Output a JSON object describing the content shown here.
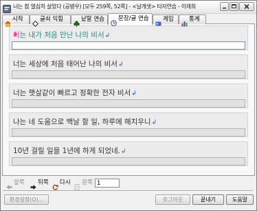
{
  "window": {
    "title": "너는 참 열심히 살았다 (공병우) [모두 259쪽, 52쪽] - <날개셋> 타자연습 - 이재희",
    "icon": "app-icon",
    "controls": [
      "minimize-icon",
      "maximize-icon",
      "close-icon"
    ]
  },
  "tabs": [
    {
      "label": "시작",
      "icon": "start-icon",
      "active": false
    },
    {
      "label": "글쇠 익힘",
      "icon": "keycap-icon",
      "active": false
    },
    {
      "label": "낱말 연습",
      "icon": "clubs-icon",
      "active": false
    },
    {
      "label": "문장/글 연습",
      "icon": "clock-icon",
      "active": true
    },
    {
      "label": "게임",
      "icon": "game-icon",
      "active": false
    },
    {
      "label": "통계",
      "icon": "bar-chart-icon",
      "active": false
    }
  ],
  "practice": {
    "line_end_symbol": "↲",
    "lines": [
      {
        "text": "너는 내가 처음 만난 나의 비서",
        "typed": "",
        "current": true
      },
      {
        "text": "너는 세상에 처음 태어난 나의 비서",
        "typed": "",
        "current": false
      },
      {
        "text": "너는 햇살같이 빠르고 정확한 전자 비서",
        "typed": "",
        "current": false
      },
      {
        "text": "나는 네 도움으로 백날 할 일, 하루에 해치우니",
        "typed": "",
        "current": false
      },
      {
        "text": "10년 걸릴 일을 1년에 하게 되었네.",
        "typed": "",
        "current": false
      }
    ]
  },
  "nav": {
    "prev": {
      "label": "앞쪽",
      "icon": "arrow-left-icon",
      "enabled": false
    },
    "next": {
      "label": "뒤쪽",
      "icon": "arrow-right-icon",
      "enabled": true
    },
    "again": {
      "label": "다시",
      "icon": "refresh-icon",
      "enabled": true
    },
    "goto": {
      "label": "갈쪽",
      "icon": "page-icon",
      "enabled": false
    },
    "page_value": "1"
  },
  "buttons": {
    "settings": {
      "label": "환경설정(O)...",
      "enabled": false
    },
    "logout": {
      "label": "로그아웃",
      "enabled": false
    },
    "exit": {
      "label": "끝내기",
      "enabled": true
    },
    "help": {
      "label": "도움말",
      "enabled": true
    }
  },
  "colors": {
    "current_line_text": "#2a8a8a",
    "line_text": "#333333",
    "cursor_marker": "#e0409a",
    "line_end_symbol": "#2b55d6"
  }
}
